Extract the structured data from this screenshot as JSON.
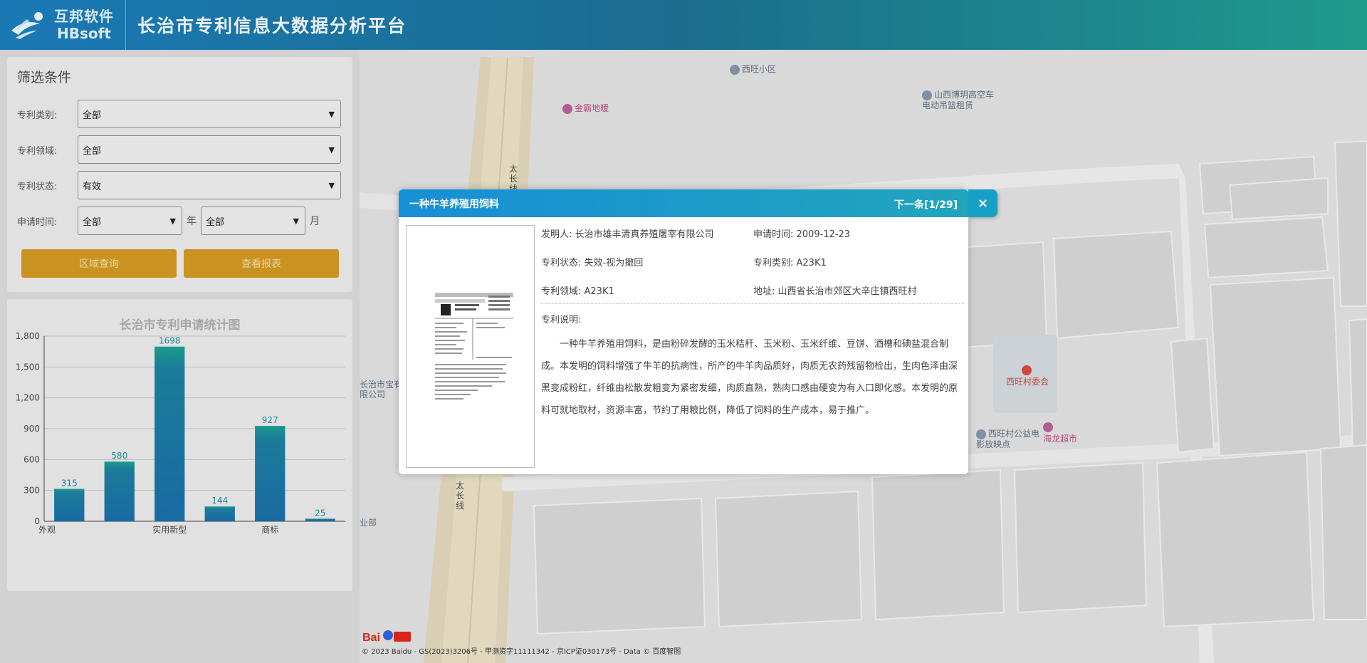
{
  "header": {
    "logo_cn": "互邦软件",
    "logo_en": "HBsoft",
    "title": "长治市专利信息大数据分析平台"
  },
  "filter": {
    "title": "筛选条件",
    "type_label": "专利类别:",
    "type_value": "全部",
    "field_label": "专利领域:",
    "field_value": "全部",
    "status_label": "专利状态:",
    "status_value": "有效",
    "time_label": "申请时间:",
    "year_value": "全部",
    "year_unit": "年",
    "month_value": "全部",
    "month_unit": "月",
    "region_btn": "区域查询",
    "report_btn": "查看报表"
  },
  "chart_data": {
    "type": "bar",
    "title": "长治市专利申请统计图",
    "categories": [
      "外观",
      "",
      "实用新型",
      "",
      "商标",
      ""
    ],
    "x_tick_labels": [
      "外观",
      "实用新型",
      "商标"
    ],
    "values": [
      315,
      580,
      1698,
      144,
      927,
      25
    ],
    "ylim": [
      0,
      1800
    ],
    "yticks": [
      "0",
      "300",
      "600",
      "900",
      "1,200",
      "1,500",
      "1,800"
    ],
    "ytick_values": [
      0,
      300,
      600,
      900,
      1200,
      1500,
      1800
    ],
    "grid": true,
    "bar_color_top": "#1a9a8a",
    "bar_color": "#1b6fa0"
  },
  "map": {
    "pois": [
      "西旺小区",
      "金霸地暖",
      "山西博玥高空车电动吊篮租赁",
      "西旺村委会",
      "西旺村公益电影放映点",
      "海龙超市",
      "长治市宝有限公司",
      "业部"
    ],
    "road_label": "太长线",
    "footer": "© 2023 Baidu - GS(2023)3206号 - 甲测资字11111342 - 京ICP证030173号 - Data © 百度智图",
    "logo_text": "Bai度地图"
  },
  "modal": {
    "title": "一种牛羊养殖用饲料",
    "next_label": "下一条[1/29]",
    "close_label": "×",
    "inventor": "发明人: 长治市雄丰清真养殖屠宰有限公司",
    "apply_time": "申请时间: 2009-12-23",
    "status": "专利状态: 失效-视为撤回",
    "category": "专利类别: A23K1",
    "field": "专利领域: A23K1",
    "address": "地址: 山西省长治市郊区大辛庄镇西旺村",
    "desc_label": "专利说明:",
    "description": "一种牛羊养殖用饲料，是由粉碎发酵的玉米秸秆、玉米粉、玉米纤维、豆饼、酒槽和碘盐混合制成。本发明的饲料增强了牛羊的抗病性，所产的牛羊肉品质好，肉质无农药残留物检出，生肉色泽由深黑变成粉红，纤维由松散发粗变为紧密发细，肉质直熟，熟肉口感由硬变为有入口即化感。本发明的原料可就地取材，资源丰富，节约了用粮比例，降低了饲料的生产成本，易于推广。"
  }
}
